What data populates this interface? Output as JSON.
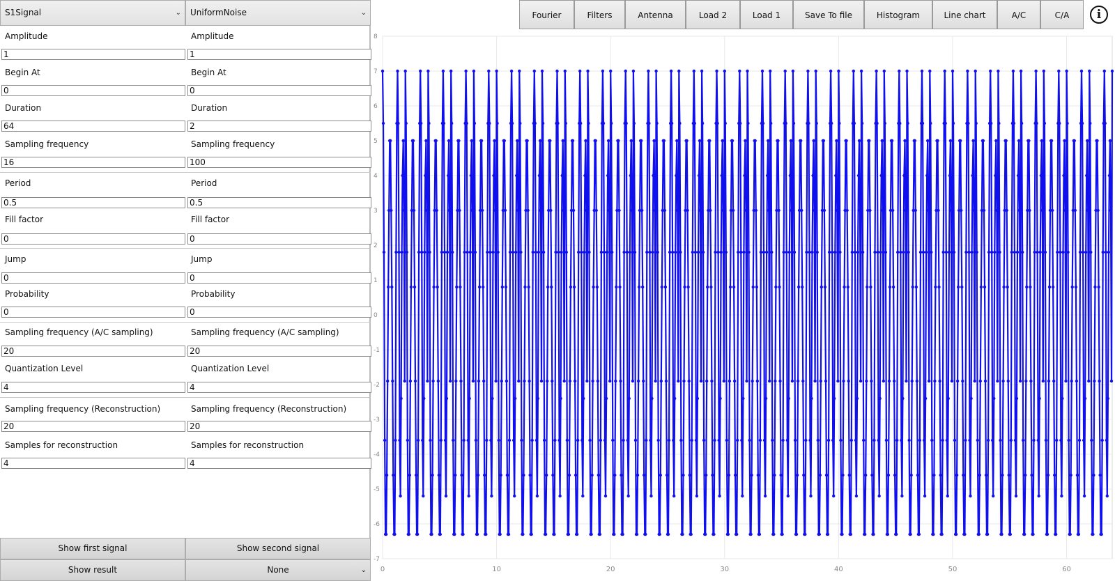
{
  "signals": {
    "first_type": "S1Signal",
    "second_type": "UniformNoise"
  },
  "fields": [
    {
      "label": "Amplitude",
      "first": "1",
      "second": "1"
    },
    {
      "label": "Begin At",
      "first": "0",
      "second": "0"
    },
    {
      "label": "Duration",
      "first": "64",
      "second": "2"
    },
    {
      "label": "Sampling frequency",
      "first": "16",
      "second": "100"
    },
    {
      "label": "Period",
      "first": "0.5",
      "second": "0.5"
    },
    {
      "label": "Fill factor",
      "first": "0",
      "second": "0"
    },
    {
      "label": "Jump",
      "first": "0",
      "second": "0"
    },
    {
      "label": "Probability",
      "first": "0",
      "second": "0"
    },
    {
      "label": "Sampling frequency (A/C sampling)",
      "first": "20",
      "second": "20"
    },
    {
      "label": "Quantization Level",
      "first": "4",
      "second": "4"
    },
    {
      "label": "Sampling frequency (Reconstruction)",
      "first": "20",
      "second": "20"
    },
    {
      "label": "Samples for reconstruction",
      "first": "4",
      "second": "4"
    }
  ],
  "buttons": {
    "show_first": "Show first signal",
    "show_second": "Show second signal",
    "show_result": "Show result",
    "operation": "None"
  },
  "toolbar": [
    "Fourier",
    "Filters",
    "Antenna",
    "Load 2",
    "Load 1",
    "Save To file",
    "Histogram",
    "Line chart",
    "A/C",
    "C/A"
  ],
  "info_icon": "info-icon",
  "colors": {
    "series": "#1010ee",
    "grid": "#e8e8e8"
  },
  "chart_data": {
    "type": "line",
    "x_range": [
      0,
      64
    ],
    "y_range": [
      -7,
      8
    ],
    "x_ticks": [
      "0",
      "10",
      "20",
      "30",
      "40",
      "50",
      "60"
    ],
    "y_ticks": [
      "-7",
      "-6",
      "-5",
      "-4",
      "-3",
      "-2",
      "-1",
      "0",
      "1",
      "2",
      "3",
      "4",
      "5",
      "6",
      "7",
      "8"
    ],
    "grid": true,
    "sample_rate": 16,
    "pattern": [
      7.0,
      5.5,
      1.8,
      -3.6,
      -6.3,
      -6.3,
      -4.6,
      -1.9,
      0.8,
      3.0,
      5.0,
      5.0,
      3.0,
      0.8,
      -1.9,
      -4.6,
      -6.3,
      -6.3,
      -3.6,
      1.8,
      5.5,
      7.0,
      5.5,
      1.8,
      -3.6,
      -5.2,
      -2.4,
      1.8,
      4.0,
      5.0,
      3.0,
      -1.9
    ],
    "series": [
      {
        "name": "",
        "color": "#1010ee"
      }
    ]
  }
}
